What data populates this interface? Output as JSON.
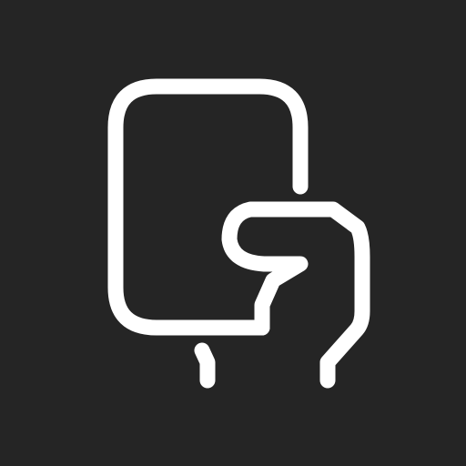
{
  "icon": {
    "name": "hand-holding-phone-icon",
    "background": "#252525",
    "stroke": "#ffffff"
  }
}
